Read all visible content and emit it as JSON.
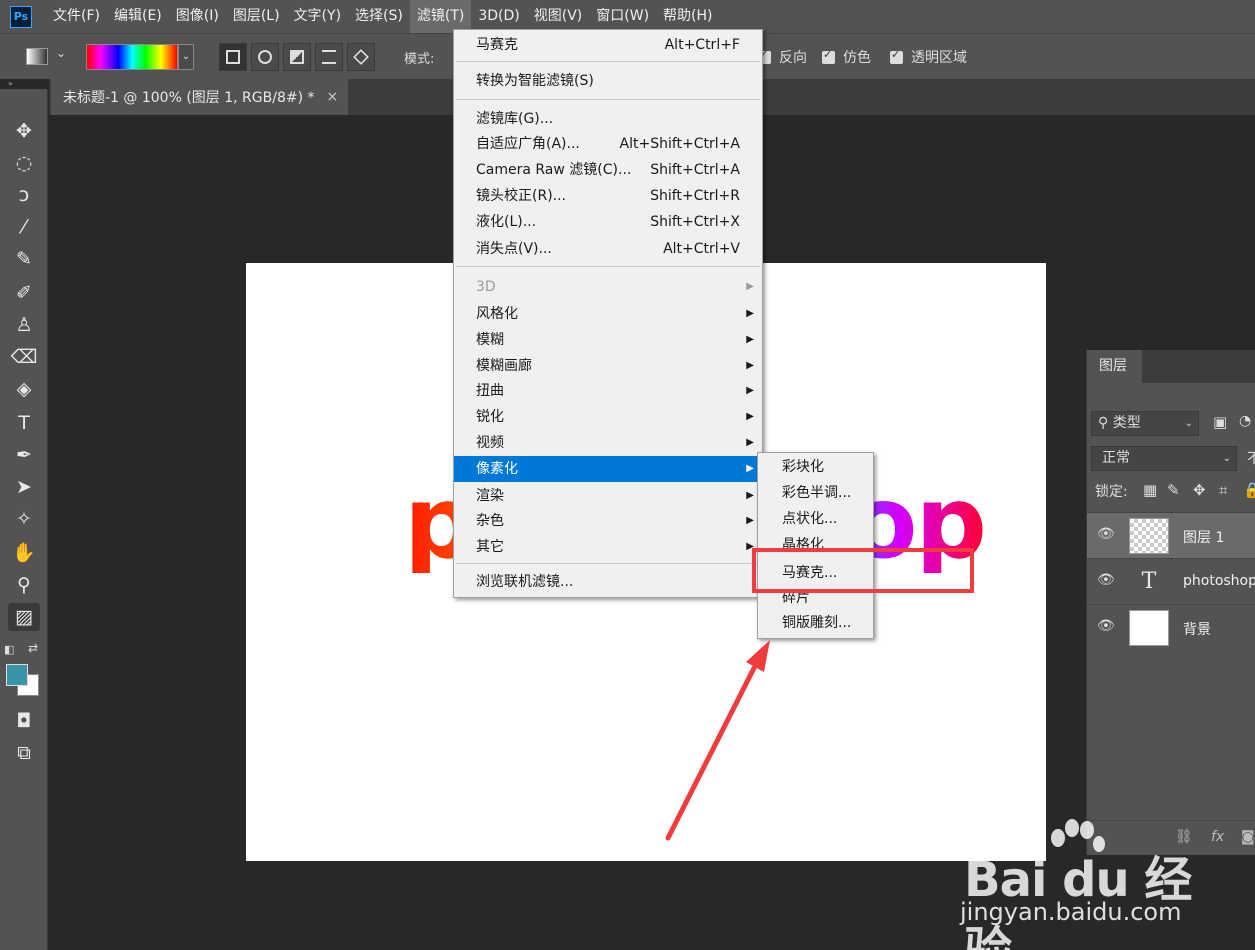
{
  "app": {
    "logo": "Ps"
  },
  "menubar": [
    "文件(F)",
    "编辑(E)",
    "图像(I)",
    "图层(L)",
    "文字(Y)",
    "选择(S)",
    "滤镜(T)",
    "3D(D)",
    "视图(V)",
    "窗口(W)",
    "帮助(H)"
  ],
  "menubar_active": "滤镜(T)",
  "options": {
    "mode_label": "模式:",
    "reverse": "反向",
    "dither": "仿色",
    "transparency": "透明区域"
  },
  "document": {
    "tab_title": "未标题-1 @ 100% (图层 1, RGB/8#) *",
    "close": "×"
  },
  "canvas": {
    "text": "photoshop"
  },
  "colors": {
    "foreground": "#3b93a7",
    "background": "#ffffff",
    "menu_highlight": "#0078d7",
    "annotation": "#f03c3c"
  },
  "filter_menu": {
    "top": [
      {
        "label": "马赛克",
        "shortcut": "Alt+Ctrl+F"
      }
    ],
    "convert": "转换为智能滤镜(S)",
    "library": [
      {
        "label": "滤镜库(G)...",
        "shortcut": ""
      },
      {
        "label": "自适应广角(A)...",
        "shortcut": "Alt+Shift+Ctrl+A"
      },
      {
        "label": "Camera Raw 滤镜(C)...",
        "shortcut": "Shift+Ctrl+A"
      },
      {
        "label": "镜头校正(R)...",
        "shortcut": "Shift+Ctrl+R"
      },
      {
        "label": "液化(L)...",
        "shortcut": "Shift+Ctrl+X"
      },
      {
        "label": "消失点(V)...",
        "shortcut": "Alt+Ctrl+V"
      }
    ],
    "groups": [
      "3D",
      "风格化",
      "模糊",
      "模糊画廊",
      "扭曲",
      "锐化",
      "视频",
      "像素化",
      "渲染",
      "杂色",
      "其它"
    ],
    "browse": "浏览联机滤镜..."
  },
  "pixelate_submenu": [
    "彩块化",
    "彩色半调...",
    "点状化...",
    "晶格化",
    "马赛克...",
    "碎片",
    "铜版雕刻..."
  ],
  "layers_panel": {
    "tab": "图层",
    "filter_kind": "类型",
    "blend_mode": "正常",
    "opacity_cut": "不",
    "lock_label": "锁定:",
    "layers": [
      {
        "name": "图层 1",
        "thumb": "checker",
        "selected": true
      },
      {
        "name": "photoshop",
        "thumb": "text",
        "selected": false
      },
      {
        "name": "背景",
        "thumb": "white",
        "selected": false
      }
    ],
    "footer": [
      "link-icon",
      "fx",
      "mask-icon"
    ]
  },
  "watermark": {
    "logo": "Bai du 经验",
    "url": "jingyan.baidu.com"
  }
}
